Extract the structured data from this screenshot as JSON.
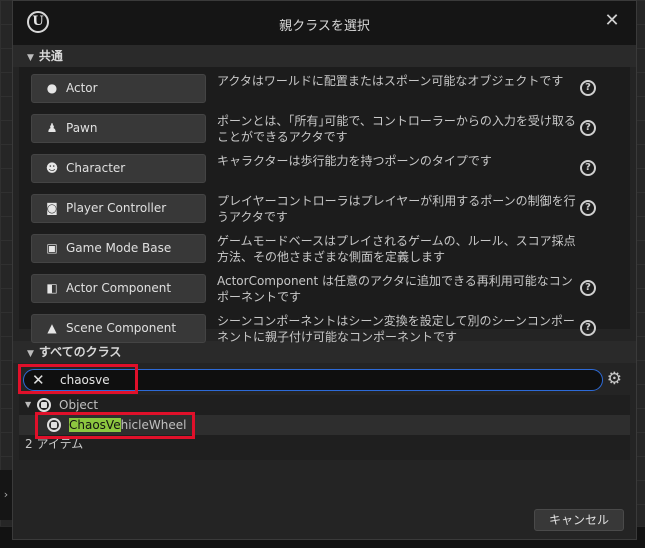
{
  "window": {
    "title": "親クラスを選択",
    "logo": "U",
    "close_icon": "✕"
  },
  "common": {
    "header": "共通",
    "items": [
      {
        "label": "Actor",
        "icon": "actor-icon",
        "glyph": "●",
        "desc": "アクタはワールドに配置またはスポーン可能なオブジェクトです"
      },
      {
        "label": "Pawn",
        "icon": "pawn-icon",
        "glyph": "♟",
        "desc": "ポーンとは、｢所有｣可能で、コントローラーからの入力を受け取ることができるアクタです"
      },
      {
        "label": "Character",
        "icon": "character-icon",
        "glyph": "☻",
        "desc": "キャラクターは歩行能力を持つポーンのタイプです"
      },
      {
        "label": "Player Controller",
        "icon": "gamepad-icon",
        "glyph": "🎮",
        "desc": "プレイヤーコントローラはプレイヤーが利用するポーンの制御を行うアクタです"
      },
      {
        "label": "Game Mode Base",
        "icon": "game-mode-icon",
        "glyph": "▣",
        "desc": "ゲームモードベースはプレイされるゲームの、ルール、スコア採点方法、その他さまざまな側面を定義します"
      },
      {
        "label": "Actor Component",
        "icon": "actor-component-icon",
        "glyph": "◧",
        "desc": "ActorComponent は任意のアクタに追加できる再利用可能なコンポーネントです"
      },
      {
        "label": "Scene Component",
        "icon": "scene-component-icon",
        "glyph": "▲",
        "desc": "シーンコンポーネントはシーン変換を設定して別のシーンコンポーネントに親子付け可能なコンポーネントです"
      }
    ]
  },
  "all_classes": {
    "header": "すべてのクラス",
    "search_value": "chaosve",
    "tree": {
      "root": "Object",
      "child_match": "ChaosVe",
      "child_rest": "hicleWheel"
    },
    "count": "2 アイテム"
  },
  "footer": {
    "cancel_label": "キャンセル"
  },
  "colors": {
    "highlight": "#8cc63f",
    "annotation_red": "#e0102a",
    "focus_blue": "#2d6ad6"
  }
}
